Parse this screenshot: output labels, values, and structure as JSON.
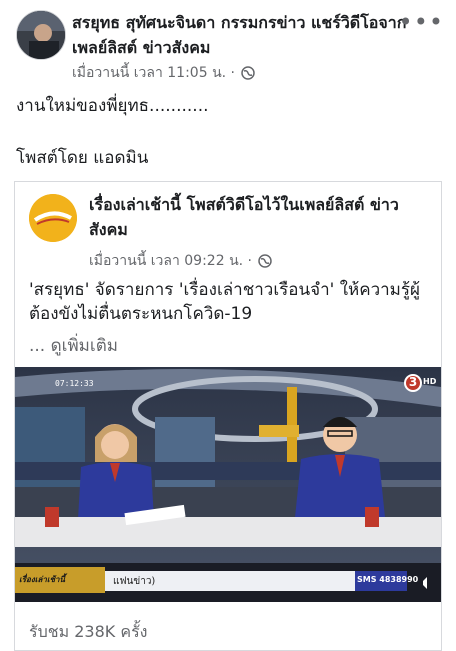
{
  "post": {
    "author_line": "สรยุทธ สุทัศนะจินดา กรรมกรข่าว แชร์วิดีโอจากเพลย์ลิสต์ ข่าวสังคม",
    "timestamp": "เมื่อวานนี้ เวลา 11:05 น. ·",
    "more_label": "•••",
    "text": "งานใหม่ของพี่ยุทธ...........",
    "text2": "โพสต์โดย แอดมิน"
  },
  "shared": {
    "title": "เรื่องเล่าเช้านี้ โพสต์วิดีโอไว้ในเพลย์ลิสต์ ข่าวสังคม",
    "timestamp": "เมื่อวานนี้ เวลา 09:22 น. ·",
    "description": "'สรยุทธ' จัดรายการ 'เรื่องเล่าชาวเรือนจำ' ให้ความรู้ผู้ต้องขังไม่ตื่นตระหนกโควิด-19",
    "see_more": "... ดูเพิ่มเติม",
    "views": "รับชม 238K ครั้ง"
  },
  "video": {
    "time_overlay": "07:12:33",
    "channel_badge": "3",
    "hd_label": "HD",
    "ticker_label": "แฟนข่าว)",
    "sms_label": "SMS 4838990",
    "logo_label": "เรื่องเล่าเช้านี้"
  },
  "icons": [
    "globe-icon",
    "more-icon",
    "volume-icon"
  ],
  "colors": {
    "meta": "#65676b",
    "text": "#1c1e21",
    "logo": "#f2b21b",
    "jacket": "#2d3a9c"
  }
}
